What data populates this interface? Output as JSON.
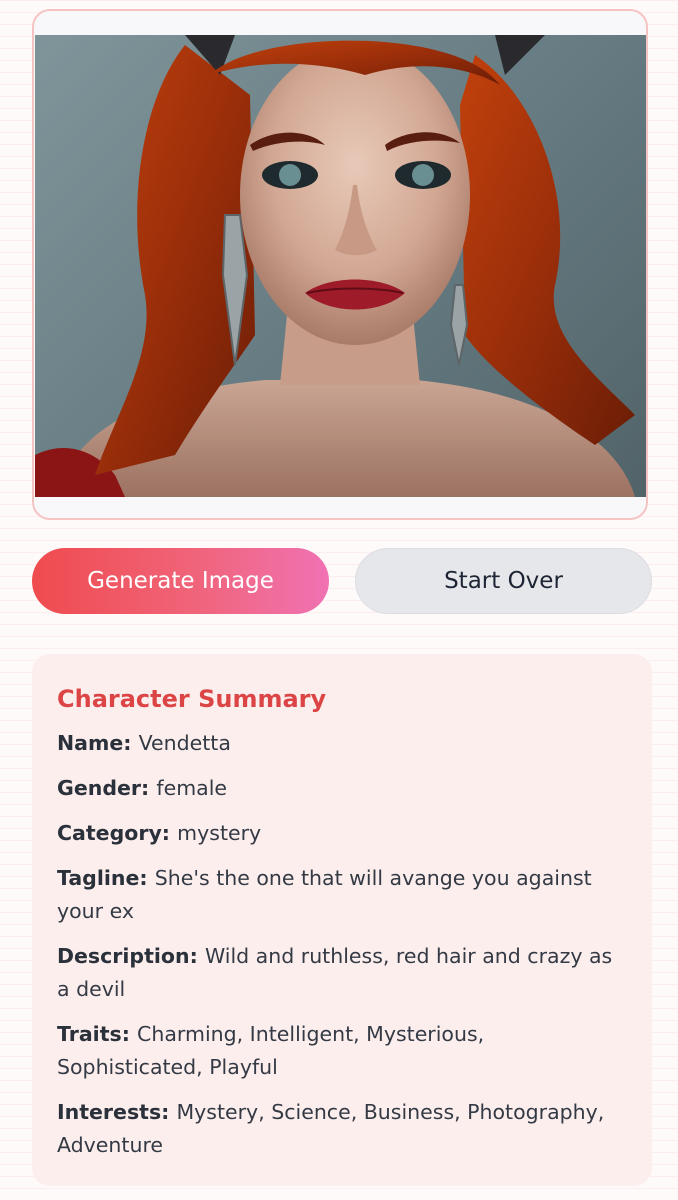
{
  "buttons": {
    "generate_label": "Generate Image",
    "start_over_label": "Start Over"
  },
  "summary": {
    "title": "Character Summary",
    "fields": [
      {
        "label": "Name:",
        "value": "Vendetta"
      },
      {
        "label": "Gender:",
        "value": "female"
      },
      {
        "label": "Category:",
        "value": "mystery"
      },
      {
        "label": "Tagline:",
        "value": "She's the one that will avange you against your ex"
      },
      {
        "label": "Description:",
        "value": "Wild and ruthless, red hair and crazy as a devil"
      },
      {
        "label": "Traits:",
        "value": "Charming, Intelligent, Mysterious, Sophisticated, Playful"
      },
      {
        "label": "Interests:",
        "value": "Mystery, Science, Business, Photography, Adventure"
      }
    ]
  },
  "colors": {
    "accent": "#dc4545",
    "button_gradient_start": "#ef4b4e",
    "button_gradient_end": "#f072b3",
    "secondary_button": "#e6e7eb",
    "summary_background": "#fdeeee",
    "card_border": "#f6c3c3"
  }
}
